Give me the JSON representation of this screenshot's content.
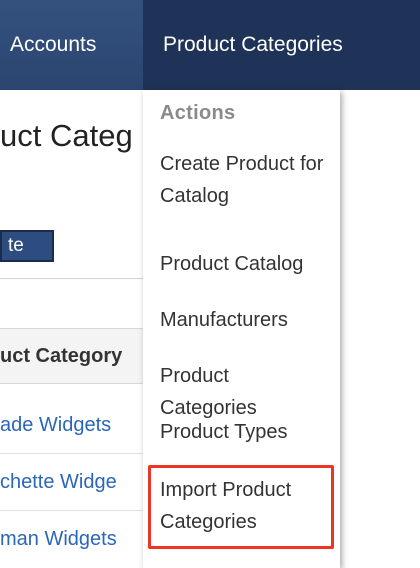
{
  "nav": {
    "accounts_label": "Accounts",
    "product_categories_label": "Product Categories"
  },
  "page": {
    "title_partial": "uct Categ",
    "button_partial": "te",
    "table_header_partial": "uct Category",
    "rows": [
      "ade Widgets",
      "chette Widge",
      "man Widgets"
    ]
  },
  "dropdown": {
    "header": "Actions",
    "items": {
      "create": "Create Product for Catalog",
      "catalog": "Product Catalog",
      "manufacturers": "Manufacturers",
      "categories": "Product Categories",
      "types": "Product Types",
      "import": "Import Product Categories"
    }
  },
  "colors": {
    "nav_bg": "#2b4570",
    "nav_active_bg": "#1f3358",
    "link": "#2b67b8",
    "highlight": "#ee3424"
  }
}
